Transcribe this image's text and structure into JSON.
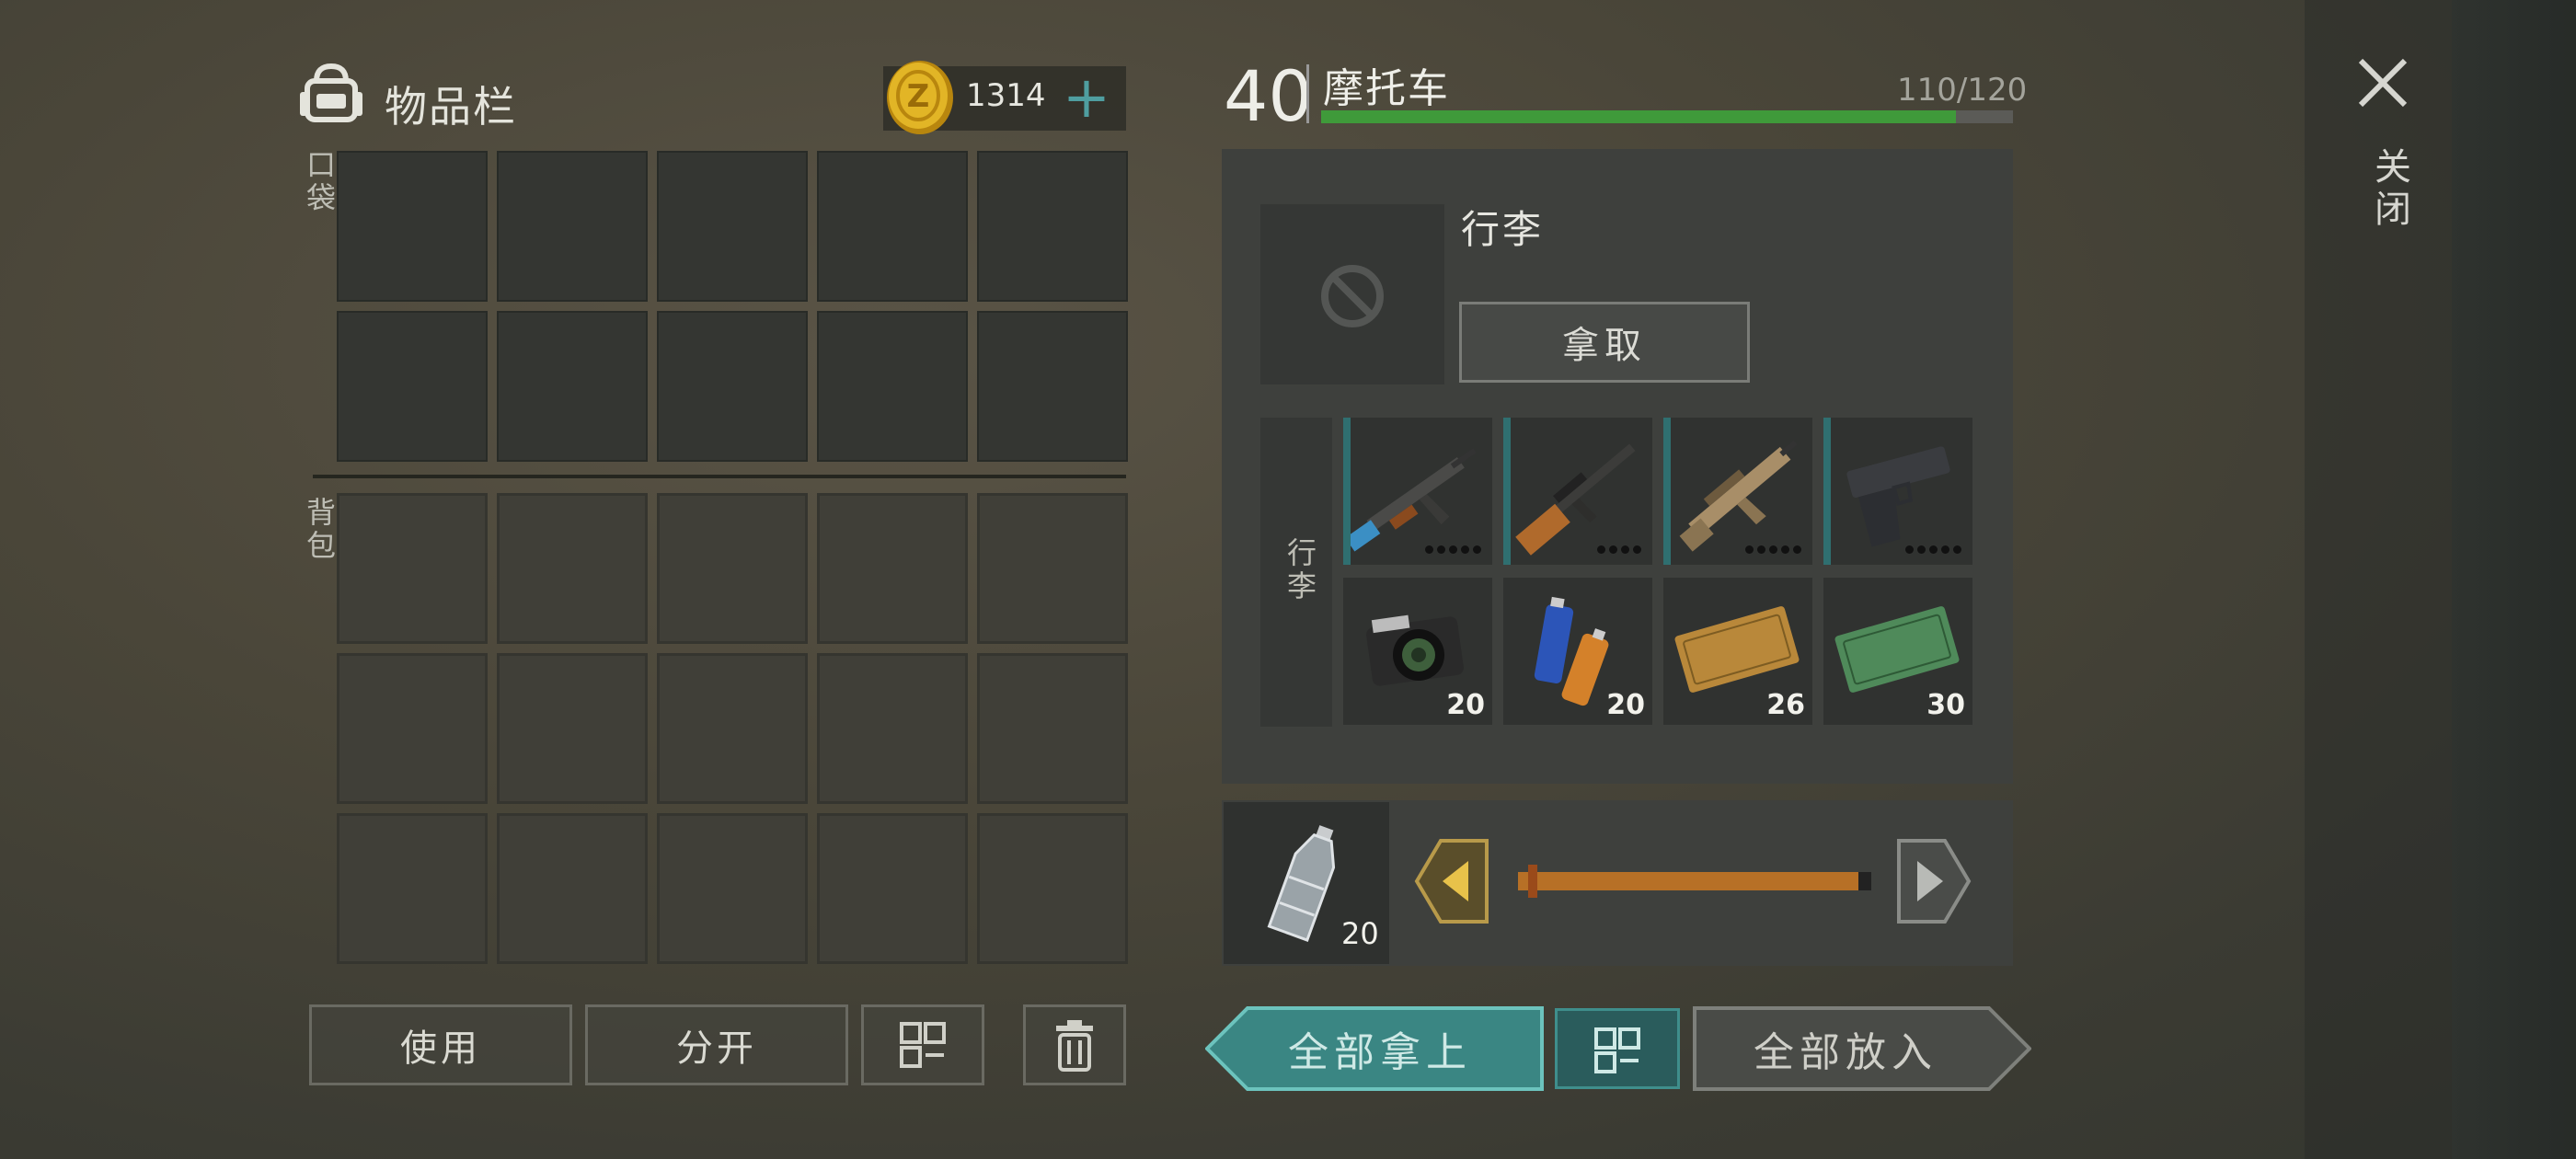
{
  "inventory": {
    "title": "物品栏",
    "coins": "1314",
    "pocket_label": "口袋",
    "backpack_label": "背包",
    "buttons": {
      "use": "使用",
      "split": "分开"
    }
  },
  "vehicle": {
    "level": "40",
    "name": "摩托车",
    "capacity": "110/120",
    "capacity_fraction": 0.917,
    "section_title": "行李",
    "take_label": "拿取",
    "side_label": "行李",
    "items": [
      {
        "name": "assault-rifle",
        "count": ""
      },
      {
        "name": "sniper-rifle",
        "count": ""
      },
      {
        "name": "tan-rifle",
        "count": ""
      },
      {
        "name": "pistol",
        "count": ""
      },
      {
        "name": "camera",
        "count": "20"
      },
      {
        "name": "batteries",
        "count": "20"
      },
      {
        "name": "survival-kit-coupon",
        "count": "26"
      },
      {
        "name": "ration-coupon",
        "count": "30"
      }
    ]
  },
  "transfer": {
    "item": "water-bottle",
    "count": "20",
    "slider_fraction": 0.03
  },
  "actions": {
    "take_all": "全部拿上",
    "put_all": "全部放入"
  },
  "close_label": "关闭",
  "colors": {
    "accent": "#4f9ea0",
    "capacity_bar": "#3f9a3a",
    "slider": "#b77026"
  }
}
